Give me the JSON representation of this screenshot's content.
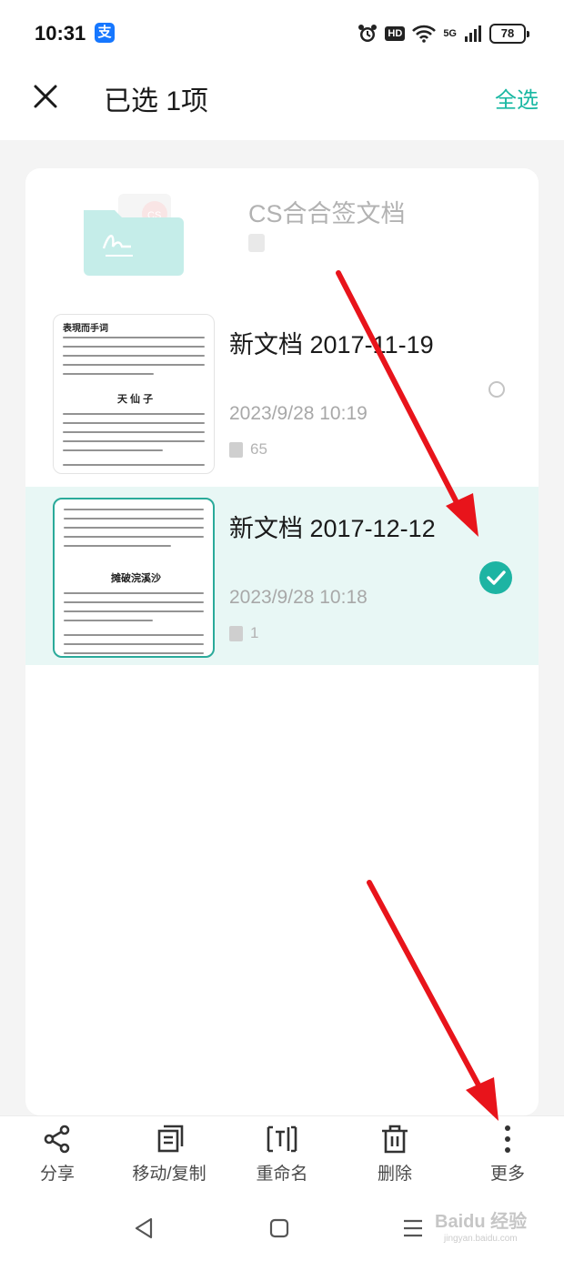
{
  "status_bar": {
    "time": "10:31",
    "alipay_glyph": "支",
    "hd_label": "HD",
    "network_label": "5G",
    "battery": "78"
  },
  "header": {
    "title": "已选 1项",
    "select_all": "全选"
  },
  "folder": {
    "name": "CS合合签文档"
  },
  "documents": [
    {
      "name": "新文档 2017-11-19",
      "date": "2023/9/28 10:19",
      "pages": "65",
      "thumb_heading": "天 仙 子",
      "thumb_top": "表現而手词",
      "selected": false
    },
    {
      "name": "新文档 2017-12-12",
      "date": "2023/9/28 10:18",
      "pages": "1",
      "thumb_heading": "摊破浣溪沙",
      "selected": true
    }
  ],
  "toolbar": {
    "share": "分享",
    "move_copy": "移动/复制",
    "rename": "重命名",
    "delete": "删除",
    "more": "更多"
  },
  "watermark": {
    "brand": "Baidu 经验",
    "url": "jingyan.baidu.com"
  },
  "colors": {
    "accent": "#19b8a3",
    "selected_row": "#e8f7f5",
    "arrow": "#e8141b"
  }
}
